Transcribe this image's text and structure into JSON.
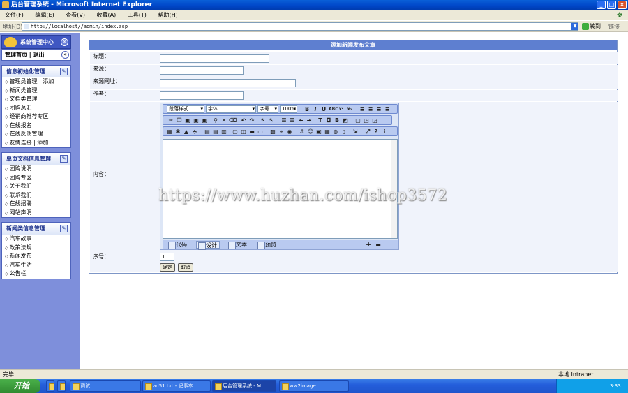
{
  "window": {
    "title": "后台管理系统 - Microsoft Internet Explorer",
    "min": "_",
    "max": "□",
    "close": "×"
  },
  "menu": [
    "文件(F)",
    "编辑(E)",
    "查看(V)",
    "收藏(A)",
    "工具(T)",
    "帮助(H)"
  ],
  "address": {
    "label": "地址(D)",
    "url": "http://localhost//admin/index.asp",
    "go": "转到",
    "links": "链接"
  },
  "sidebar": {
    "header": "系统管理中心",
    "nav": "管理首页 | 退出",
    "nav_back": "«",
    "panels": [
      {
        "title": "信息初始化管理",
        "items": [
          "管理员管理 | 添加",
          "新闻类管理",
          "文档类管理",
          "团购总汇",
          "经销商推荐专区",
          "在线报名",
          "在线反馈管理",
          "友情连接 | 添加"
        ]
      },
      {
        "title": "单页文档信息管理",
        "items": [
          "团购说明",
          "团购专区",
          "关于我们",
          "联系我们",
          "在线招聘",
          "网站声明"
        ]
      },
      {
        "title": "新闻类信息管理",
        "items": [
          "汽车故事",
          "政策法规",
          "新闻发布",
          "汽车生活",
          "公告栏"
        ]
      }
    ]
  },
  "form": {
    "header": "添加新闻发布文章",
    "title_label": "标题：",
    "source_label": "来源：",
    "source_url_label": "来源网址：",
    "author_label": "作者：",
    "content_label": "内容：",
    "order_label": "序号：",
    "order_value": "1",
    "confirm": "确定",
    "cancel": "取消"
  },
  "editor": {
    "paragraph": "段落样式",
    "font": "字体",
    "size": "字号",
    "zoom": "100%",
    "tabs": [
      "代码",
      "设计",
      "文本",
      "预览"
    ],
    "active_tab": "设计"
  },
  "watermark": "https://www.huzhan.com/ishop3572",
  "status": {
    "left": "完毕",
    "zone": "本地 Intranet"
  },
  "taskbar": {
    "start": "开始",
    "tasks": [
      "调试",
      "ad51.txt - 记事本",
      "后台管理系统 - M...",
      "ww2image"
    ],
    "active_task": "后台管理系统 - M...",
    "clock": "3:33"
  }
}
